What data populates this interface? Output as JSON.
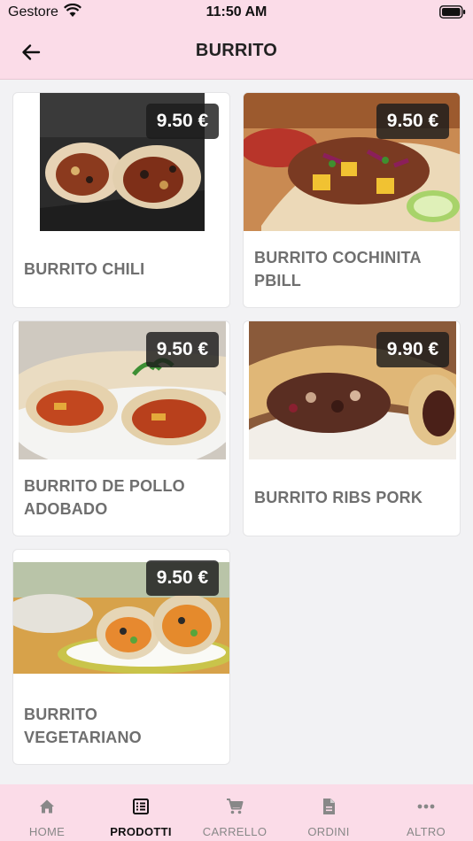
{
  "status_bar": {
    "carrier": "Gestore",
    "time": "11:50 AM"
  },
  "header": {
    "title": "BURRITO"
  },
  "products": [
    {
      "name": "BURRITO CHILI",
      "price": "9.50 €"
    },
    {
      "name": "BURRITO COCHINITA PBILL",
      "price": "9.50 €"
    },
    {
      "name": "BURRITO DE POLLO ADOBADO",
      "price": "9.50 €"
    },
    {
      "name": "BURRITO RIBS PORK",
      "price": "9.90 €"
    },
    {
      "name": "BURRITO VEGETARIANO",
      "price": "9.50 €"
    }
  ],
  "tabs": [
    {
      "label": "HOME",
      "icon": "home-icon",
      "active": false
    },
    {
      "label": "PRODOTTI",
      "icon": "list-icon",
      "active": true
    },
    {
      "label": "CARRELLO",
      "icon": "cart-icon",
      "active": false
    },
    {
      "label": "ORDINI",
      "icon": "document-icon",
      "active": false
    },
    {
      "label": "ALTRO",
      "icon": "more-icon",
      "active": false
    }
  ],
  "colors": {
    "bar_background": "#fbdce8",
    "price_badge": "#1c1c1c",
    "product_name": "#6f6f6f",
    "active_tab": "#111111",
    "inactive_tab": "#888888"
  }
}
